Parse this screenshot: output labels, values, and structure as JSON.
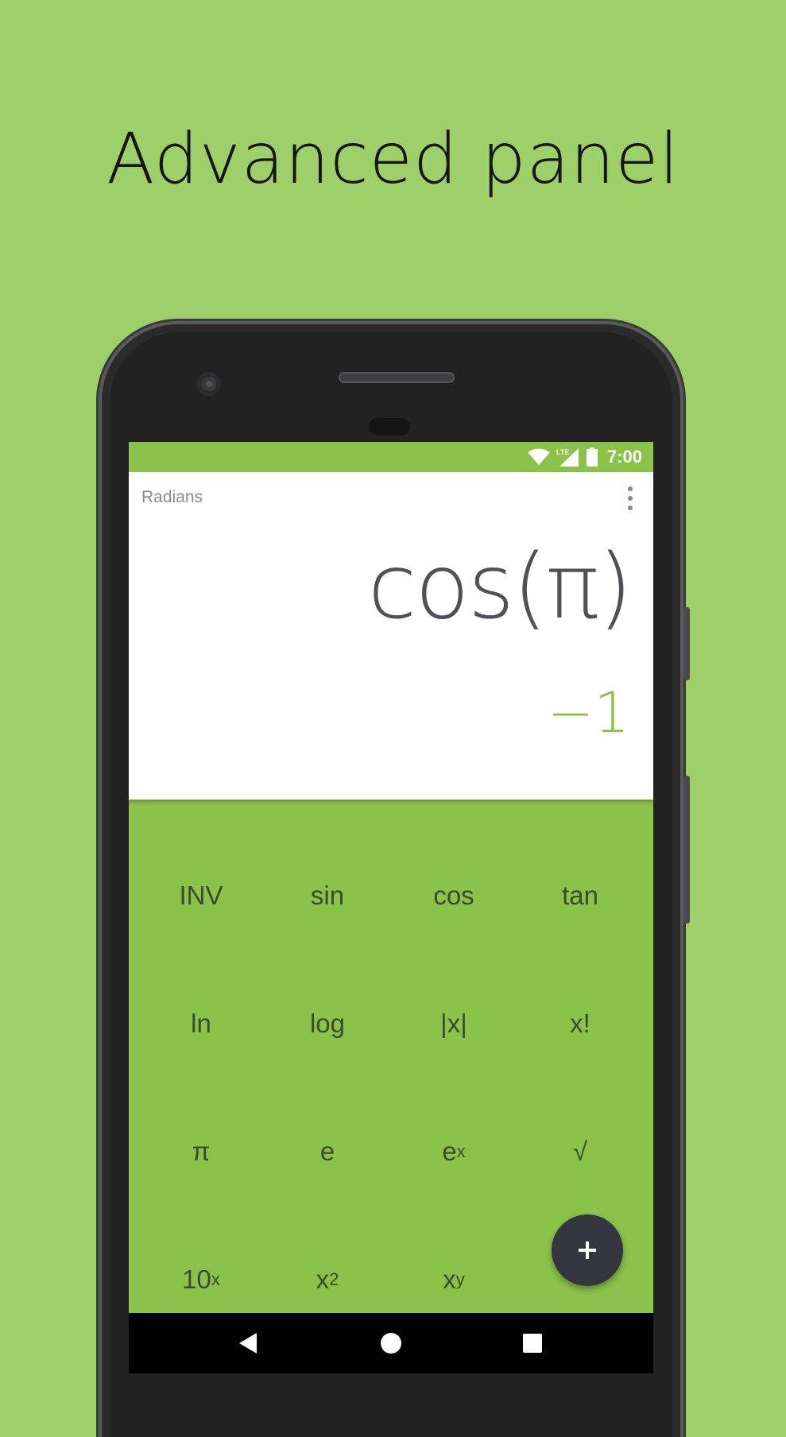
{
  "headline": "Advanced panel",
  "status_bar": {
    "network_label": "LTE",
    "time": "7:00",
    "icons": [
      "wifi-icon",
      "lte-signal-icon",
      "battery-icon"
    ]
  },
  "display": {
    "angle_mode": "Radians",
    "formula": "cos(π)",
    "result": "−1",
    "overflow_icon": "more-vert-icon"
  },
  "keypad": {
    "rows": [
      [
        {
          "label": "INV"
        },
        {
          "label": "sin"
        },
        {
          "label": "cos"
        },
        {
          "label": "tan"
        }
      ],
      [
        {
          "label": "ln"
        },
        {
          "label": "log"
        },
        {
          "label": "|x|"
        },
        {
          "label": "x!"
        }
      ],
      [
        {
          "label": "π"
        },
        {
          "label": "e"
        },
        {
          "base": "e",
          "sup": "x"
        },
        {
          "label": "√"
        }
      ],
      [
        {
          "base": "10",
          "sup": "x"
        },
        {
          "base": "x",
          "sup": "2"
        },
        {
          "base": "x",
          "sup": "y"
        }
      ]
    ]
  },
  "fab_icon": "plus-icon",
  "nav": [
    "back-icon",
    "home-icon",
    "recents-icon"
  ],
  "colors": {
    "background": "#9ecf68",
    "accent": "#8bc34a",
    "fab": "#353540",
    "formula": "#505055"
  }
}
